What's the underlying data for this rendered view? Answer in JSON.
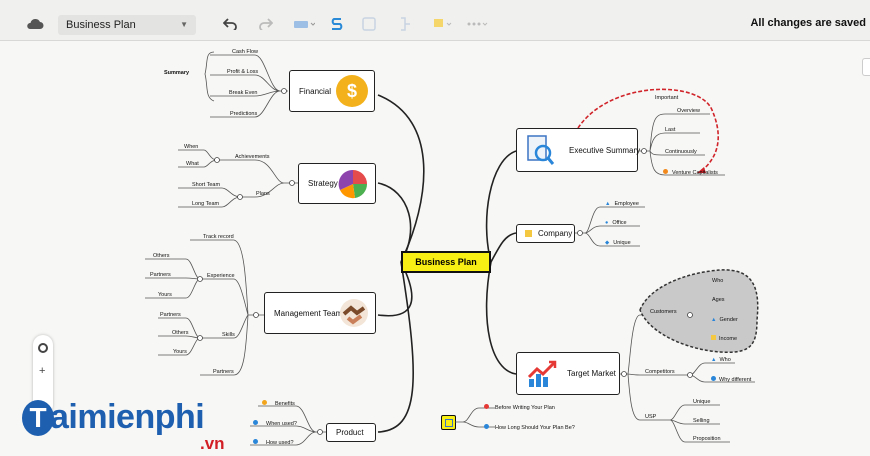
{
  "toolbar": {
    "document_name": "Business Plan",
    "save_status": "All changes are saved",
    "icons": [
      "cloud-icon",
      "undo-icon",
      "redo-icon",
      "insert-topic-icon",
      "relationship-icon",
      "boundary-icon",
      "summary-icon",
      "marker-icon",
      "more-icon"
    ]
  },
  "mindmap": {
    "root": "Business Plan",
    "financial": {
      "label": "Financial",
      "summary_label": "Summary",
      "items": [
        "Cash Flow",
        "Profit & Loss",
        "Break Even",
        "Predictions"
      ]
    },
    "strategy": {
      "label": "Strategy",
      "achievements": "Achievements",
      "achievements_items": [
        "When",
        "What"
      ],
      "plans": "Plans",
      "plans_items": [
        "Short Team",
        "Long Team"
      ]
    },
    "management": {
      "label": "Management Team",
      "track_record": "Track record",
      "experience": "Experience",
      "experience_items": [
        "Others",
        "Partners",
        "Yours"
      ],
      "skills": "Skills",
      "skills_items": [
        "Partners",
        "Others",
        "Yours"
      ],
      "partners": "Partners"
    },
    "product": {
      "label": "Product",
      "items": [
        "Benefits",
        "When used?",
        "How used?"
      ]
    },
    "executive": {
      "label": "Executive Summary",
      "important": "Important",
      "items": [
        "Overview",
        "Last",
        "Continuously",
        "Venture Capitalists"
      ]
    },
    "company": {
      "label": "Company",
      "items": [
        "Employee",
        "Office",
        "Unique"
      ]
    },
    "target": {
      "label": "Target Market",
      "customers": "Customers",
      "customers_items": [
        "Who",
        "Ages",
        "Gender",
        "Income"
      ],
      "competitors": "Competitors",
      "competitors_items": [
        "Who",
        "Why different"
      ],
      "usp": "USP",
      "usp_items": [
        "Unique",
        "Selling",
        "Proposition"
      ]
    },
    "floating": [
      "Before Writing Your Plan",
      "How Long Should Your Plan Be?"
    ]
  },
  "zoom_controls": {
    "plus": "+"
  },
  "watermark": {
    "initial": "T",
    "name": "aimienphi",
    "domain": ".vn"
  }
}
